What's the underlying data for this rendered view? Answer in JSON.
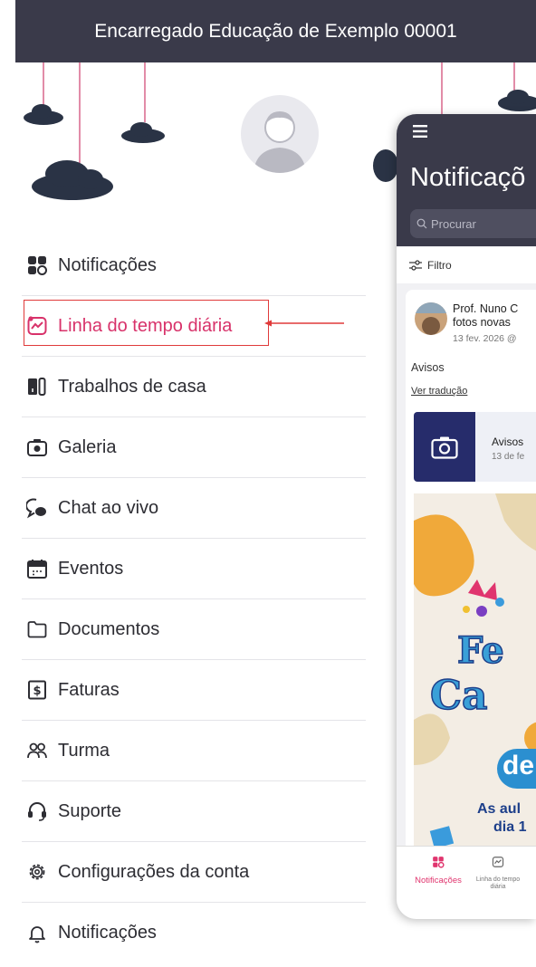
{
  "header": {
    "title": "Encarregado Educação de Exemplo 00001"
  },
  "menu": {
    "items": [
      {
        "label": "Notificações",
        "icon": "grid-icon"
      },
      {
        "label": "Linha do tempo diária",
        "icon": "timeline-icon",
        "highlighted": true
      },
      {
        "label": "Trabalhos de casa",
        "icon": "books-icon"
      },
      {
        "label": "Galeria",
        "icon": "camera-icon"
      },
      {
        "label": "Chat ao vivo",
        "icon": "chat-icon"
      },
      {
        "label": "Eventos",
        "icon": "calendar-icon"
      },
      {
        "label": "Documentos",
        "icon": "folder-icon"
      },
      {
        "label": "Faturas",
        "icon": "invoice-icon"
      },
      {
        "label": "Turma",
        "icon": "people-icon"
      },
      {
        "label": "Suporte",
        "icon": "headset-icon"
      },
      {
        "label": "Configurações da conta",
        "icon": "gear-icon"
      },
      {
        "label": "Notificações",
        "icon": "bell-icon"
      }
    ]
  },
  "highlight_color": "#e03a3a",
  "preview": {
    "title": "Notificaçõ",
    "search_placeholder": "Procurar",
    "filter_label": "Filtro",
    "post": {
      "author": "Prof. Nuno C",
      "subtitle": "fotos novas",
      "date": "13 fev. 2026 @",
      "category": "Avisos",
      "translate_link": "Ver tradução",
      "album_title": "Avisos",
      "album_date": "13 de fe"
    },
    "poster_text": {
      "line1": "Fe",
      "line2": "Ca",
      "line3": "de",
      "line4": "As aul",
      "line5": "dia 1"
    },
    "tabs": [
      {
        "label": "Notificações",
        "active": true
      },
      {
        "label": "Linha do tempo diária",
        "active": false
      }
    ],
    "accent": "#e0356e",
    "header_color": "#3a3a4a"
  }
}
